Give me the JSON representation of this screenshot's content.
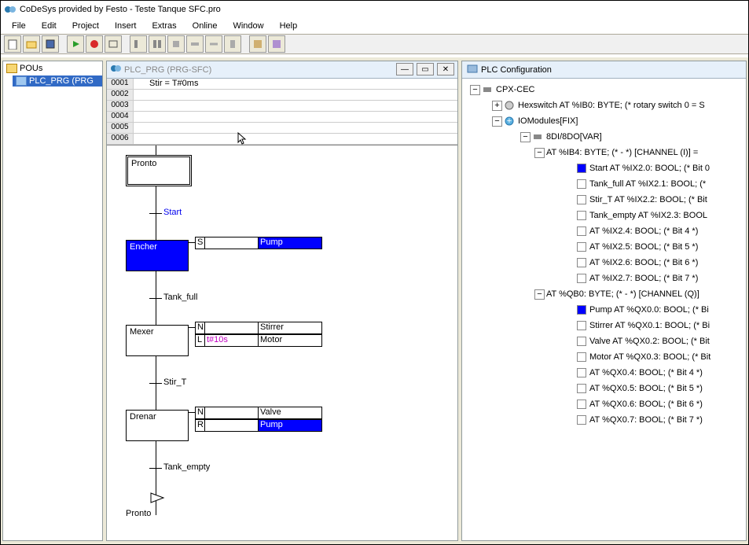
{
  "titlebar": {
    "title": "CoDeSys provided by Festo - Teste Tanque SFC.pro"
  },
  "menus": [
    "File",
    "Edit",
    "Project",
    "Insert",
    "Extras",
    "Online",
    "Window",
    "Help"
  ],
  "left": {
    "root": "POUs",
    "pou": "PLC_PRG (PRG"
  },
  "mid": {
    "tab": "PLC_PRG (PRG-SFC)",
    "varrows": [
      "0001",
      "0002",
      "0003",
      "0004",
      "0005",
      "0006"
    ],
    "vartext": "Stir = T#0ms",
    "steps": {
      "pronto": "Pronto",
      "encher": "Encher",
      "mexer": "Mexer",
      "drenar": "Drenar",
      "prontoEnd": "Pronto"
    },
    "trans": {
      "start": "Start",
      "tank_full": "Tank_full",
      "stir_t": "Stir_T",
      "tank_empty": "Tank_empty"
    },
    "actions": {
      "encher_q": "S",
      "encher_v": "Pump",
      "mexer1_q": "N",
      "mexer1_v": "Stirrer",
      "mexer2_q": "L",
      "mexer2_t": "t#10s",
      "mexer2_v": "Motor",
      "drenar1_q": "N",
      "drenar1_v": "Valve",
      "drenar2_q": "R",
      "drenar2_v": "Pump"
    }
  },
  "right": {
    "title": "PLC Configuration",
    "cpx": "CPX-CEC",
    "hex": "Hexswitch AT %IB0: BYTE; (* rotary switch 0 = S",
    "iom": "IOModules[FIX]",
    "dio": "8DI/8DO[VAR]",
    "chI": "AT %IB4: BYTE; (* - *) [CHANNEL (I)] =",
    "in": [
      "Start AT %IX2.0: BOOL; (* Bit 0",
      "Tank_full AT %IX2.1: BOOL; (*",
      "Stir_T AT %IX2.2: BOOL; (* Bit",
      "Tank_empty AT %IX2.3: BOOL",
      "AT %IX2.4: BOOL; (* Bit 4 *)",
      "AT %IX2.5: BOOL; (* Bit 5 *)",
      "AT %IX2.6: BOOL; (* Bit 6 *)",
      "AT %IX2.7: BOOL; (* Bit 7 *)"
    ],
    "chQ": "AT %QB0: BYTE; (* - *) [CHANNEL (Q)]",
    "out": [
      "Pump AT %QX0.0: BOOL; (* Bi",
      "Stirrer AT %QX0.1: BOOL; (* Bi",
      "Valve AT %QX0.2: BOOL; (* Bit",
      "Motor AT %QX0.3: BOOL; (* Bit",
      "AT %QX0.4: BOOL; (* Bit 4 *)",
      "AT %QX0.5: BOOL; (* Bit 5 *)",
      "AT %QX0.6: BOOL; (* Bit 6 *)",
      "AT %QX0.7: BOOL; (* Bit 7 *)"
    ]
  }
}
